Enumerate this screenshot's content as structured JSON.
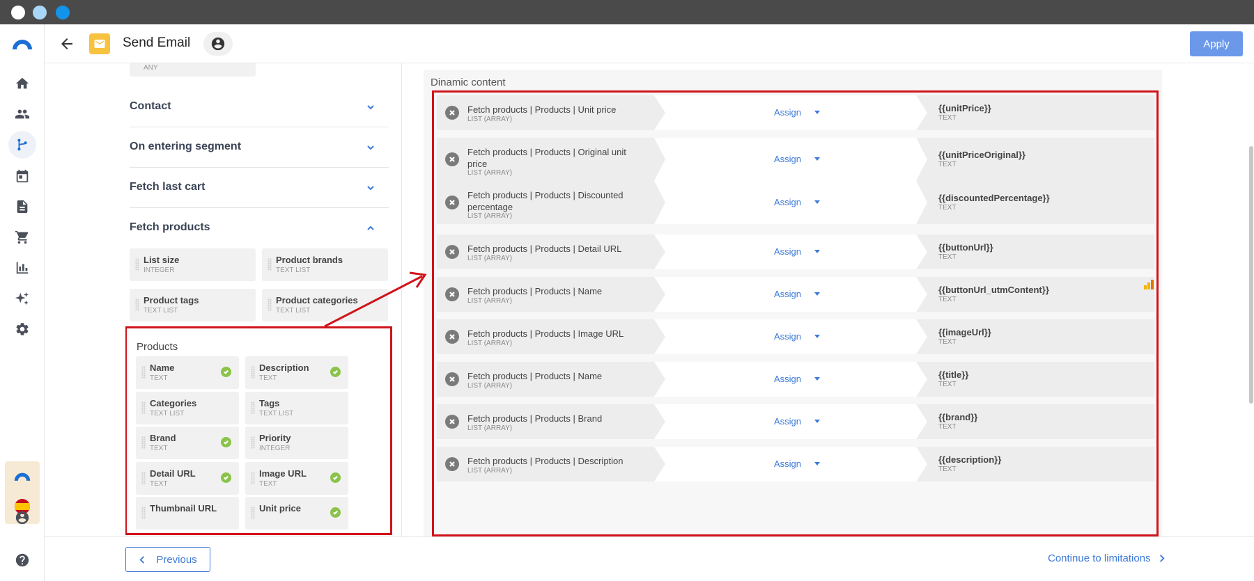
{
  "header": {
    "title": "Send Email",
    "apply_label": "Apply"
  },
  "left": {
    "any_label": "ANY",
    "accordions": [
      {
        "title": "Contact"
      },
      {
        "title": "On entering segment"
      },
      {
        "title": "Fetch last cart"
      },
      {
        "title": "Fetch products"
      }
    ],
    "fetch_products_tiles": [
      {
        "name": "List size",
        "type": "INTEGER"
      },
      {
        "name": "Product brands",
        "type": "TEXT LIST"
      },
      {
        "name": "Product tags",
        "type": "TEXT LIST"
      },
      {
        "name": "Product categories",
        "type": "TEXT LIST"
      }
    ],
    "products": {
      "title": "Products",
      "tiles": [
        {
          "name": "Name",
          "type": "TEXT",
          "checked": true
        },
        {
          "name": "Description",
          "type": "TEXT",
          "checked": true
        },
        {
          "name": "Categories",
          "type": "TEXT LIST",
          "checked": false
        },
        {
          "name": "Tags",
          "type": "TEXT LIST",
          "checked": false
        },
        {
          "name": "Brand",
          "type": "TEXT",
          "checked": true
        },
        {
          "name": "Priority",
          "type": "INTEGER",
          "checked": false
        },
        {
          "name": "Detail URL",
          "type": "TEXT",
          "checked": true
        },
        {
          "name": "Image URL",
          "type": "TEXT",
          "checked": true
        },
        {
          "name": "Thumbnail URL",
          "type": "",
          "checked": false
        },
        {
          "name": "Unit price",
          "type": "",
          "checked": true
        }
      ]
    }
  },
  "dynamic": {
    "label": "Dinamic content",
    "assign_label": "Assign",
    "rows": [
      {
        "source": "Fetch products | Products | Unit price",
        "source_type": "LIST (ARRAY)",
        "target": "{{unitPrice}}",
        "target_type": "TEXT"
      },
      {
        "source": "Fetch products | Products | Original unit price",
        "source_type": "LIST (ARRAY)",
        "target": "{{unitPriceOriginal}}",
        "target_type": "TEXT"
      },
      {
        "source": "Fetch products | Products | Discounted percentage",
        "source_type": "LIST (ARRAY)",
        "target": "{{discountedPercentage}}",
        "target_type": "TEXT"
      },
      {
        "source": "Fetch products | Products | Detail URL",
        "source_type": "LIST (ARRAY)",
        "target": "{{buttonUrl}}",
        "target_type": "TEXT"
      },
      {
        "source": "Fetch products | Products | Name",
        "source_type": "LIST (ARRAY)",
        "target": "{{buttonUrl_utmContent}}",
        "target_type": "TEXT"
      },
      {
        "source": "Fetch products | Products | Image URL",
        "source_type": "LIST (ARRAY)",
        "target": "{{imageUrl}}",
        "target_type": "TEXT"
      },
      {
        "source": "Fetch products | Products | Name",
        "source_type": "LIST (ARRAY)",
        "target": "{{title}}",
        "target_type": "TEXT"
      },
      {
        "source": "Fetch products | Products | Brand",
        "source_type": "LIST (ARRAY)",
        "target": "{{brand}}",
        "target_type": "TEXT"
      },
      {
        "source": "Fetch products | Products | Description",
        "source_type": "LIST (ARRAY)",
        "target": "{{description}}",
        "target_type": "TEXT"
      }
    ]
  },
  "footer": {
    "previous_label": "Previous",
    "continue_label": "Continue to limitations"
  },
  "colors": {
    "accent": "#3c7ad8",
    "apply_bg": "#6c98ea",
    "highlight_red": "#d0141b",
    "check_green": "#8bc34a",
    "mail_yellow": "#f7c23d"
  },
  "icons": {
    "nav": [
      "logo-icon",
      "home-icon",
      "contacts-icon",
      "automation-icon",
      "calendar-icon",
      "document-icon",
      "cart-icon",
      "chart-icon",
      "sparkles-icon",
      "gear-icon",
      "account-icon",
      "help-icon"
    ]
  }
}
